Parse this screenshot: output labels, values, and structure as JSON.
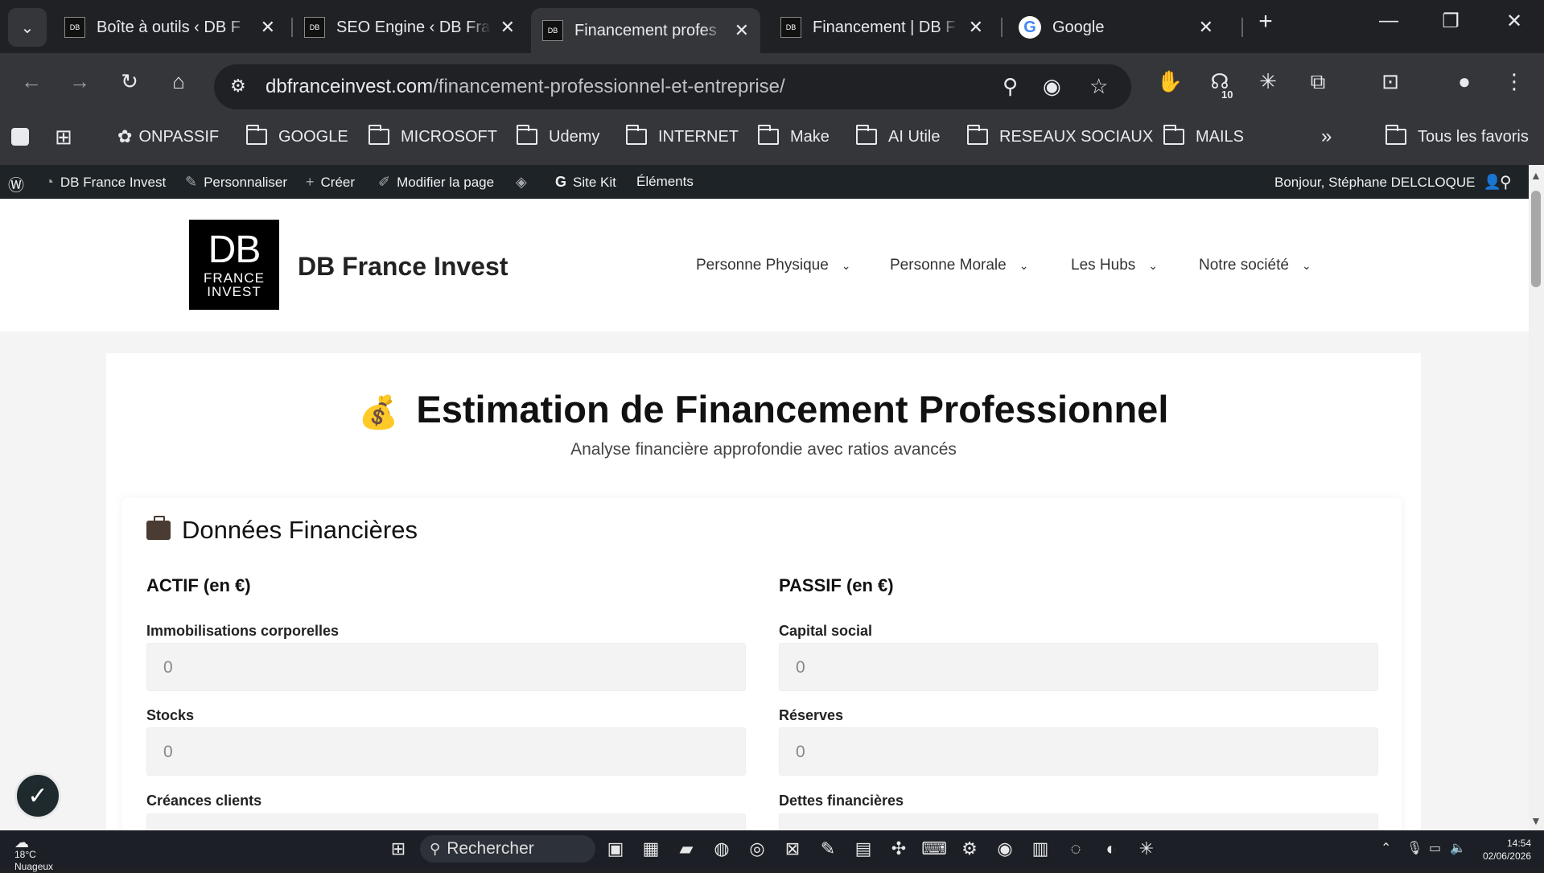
{
  "browser": {
    "tabs": [
      {
        "title": "Boîte à outils ‹ DB F",
        "fav": "DB"
      },
      {
        "title": "SEO Engine ‹ DB Fra",
        "fav": "DB"
      },
      {
        "title": "Financement profes",
        "fav": "DB"
      },
      {
        "title": "Financement | DB F",
        "fav": "DB"
      },
      {
        "title": "Google",
        "fav": "G"
      }
    ],
    "url_domain": "dbfranceinvest.com",
    "url_path": "/financement-professionnel-et-entreprise/",
    "extension_badge": "10",
    "bookmarks": [
      "ONPASSIF",
      "GOOGLE",
      "MICROSOFT",
      "Udemy",
      "INTERNET",
      "Make",
      "AI Utile",
      "RESEAUX SOCIAUX",
      "MAILS"
    ],
    "all_bookmarks": "Tous les favoris"
  },
  "wp": {
    "site": "DB France Invest",
    "customize": "Personnaliser",
    "new": "Créer",
    "edit": "Modifier la page",
    "sitekit": "Site Kit",
    "elements": "Éléments",
    "greeting": "Bonjour, Stéphane DELCLOQUE"
  },
  "site": {
    "logo_main": "DB",
    "logo_sub1": "FRANCE",
    "logo_sub2": "INVEST",
    "name": "DB France Invest",
    "menu": [
      "Personne Physique",
      "Personne Morale",
      "Les Hubs",
      "Notre société"
    ]
  },
  "main": {
    "title": "Estimation de Financement Professionnel",
    "subtitle": "Analyse financière approfondie avec ratios avancés",
    "section": "Données Financières",
    "actif_title": "ACTIF (en €)",
    "passif_title": "PASSIF (en €)",
    "actif": [
      {
        "label": "Immobilisations corporelles",
        "placeholder": "0"
      },
      {
        "label": "Stocks",
        "placeholder": "0"
      },
      {
        "label": "Créances clients",
        "placeholder": ""
      }
    ],
    "passif": [
      {
        "label": "Capital social",
        "placeholder": "0"
      },
      {
        "label": "Réserves",
        "placeholder": "0"
      },
      {
        "label": "Dettes financières",
        "placeholder": ""
      }
    ]
  },
  "taskbar": {
    "temp": "18°C",
    "weather": "Nuageux",
    "search": "Rechercher",
    "time": "14:54",
    "date": "02/06/2026"
  }
}
